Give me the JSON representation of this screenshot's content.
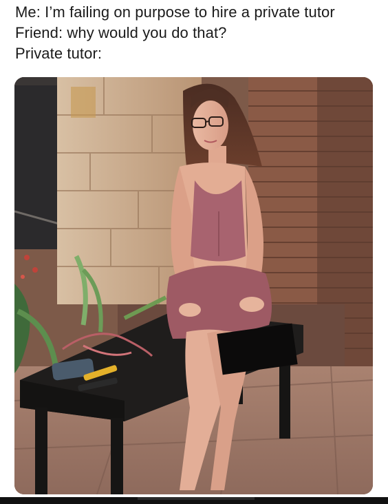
{
  "caption": {
    "lines": [
      "Me: I’m failing on purpose to hire a private tutor",
      "Friend: why would you do that?",
      "Private tutor:"
    ]
  },
  "photo": {
    "icon": "meme-photo"
  },
  "colors": {
    "text": "#1a1a1a",
    "background": "#ffffff",
    "brick": "#8b5a45",
    "stone": "#c9a98a",
    "dress": "#a8636f",
    "bench": "#1f1d1c",
    "floor": "#b08978"
  }
}
